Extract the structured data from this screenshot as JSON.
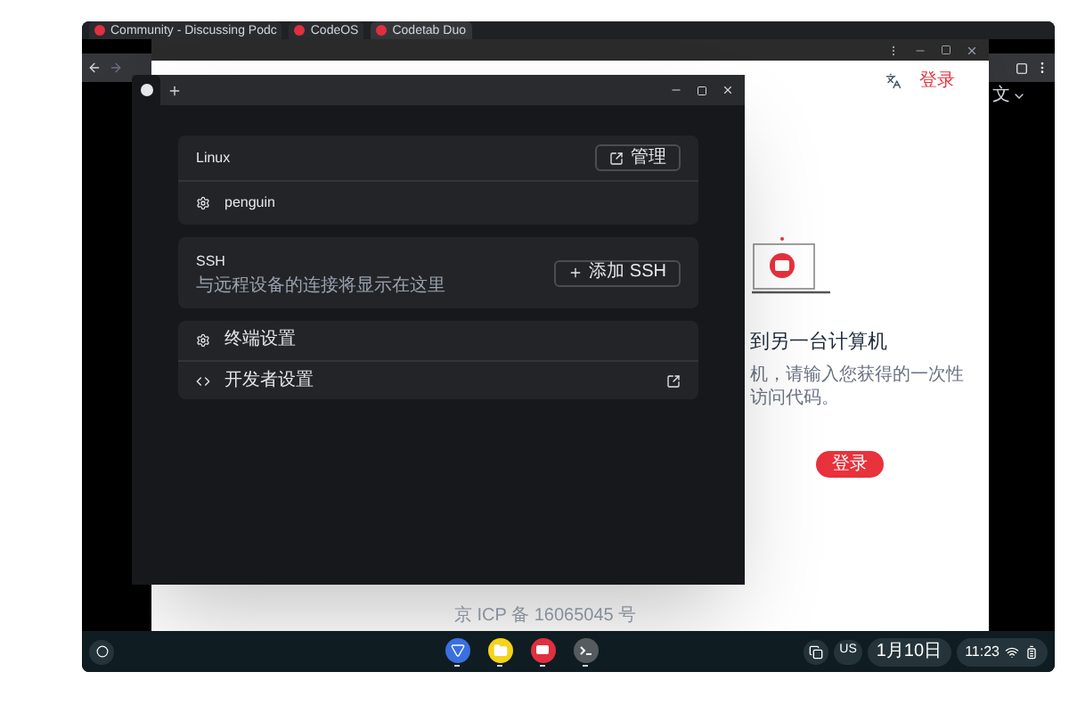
{
  "browser": {
    "tabs": [
      {
        "title": "Community - Discussing Podc",
        "selected": false
      },
      {
        "title": "CodeOS",
        "selected": false
      },
      {
        "title": "Codetab Duo",
        "selected": true
      }
    ]
  },
  "web_page": {
    "language": "文",
    "login_link": "登录",
    "heading": "到另一台计算机",
    "description": "机，请输入您获得的一次性访问代码。",
    "login_button": "登录",
    "footer": "京 ICP 备 16065045 号"
  },
  "terminal": {
    "tabs": [
      {
        "kind": "home",
        "selected": true
      },
      {
        "kind": "new",
        "selected": false
      }
    ],
    "linux": {
      "title": "Linux",
      "manage_button": "管理",
      "containers": [
        {
          "name": "penguin"
        }
      ]
    },
    "ssh": {
      "title": "SSH",
      "add_button": "添加 SSH",
      "description": "与远程设备的连接将显示在这里"
    },
    "settings": [
      {
        "kind": "gear",
        "label": "终端设置",
        "external": false
      },
      {
        "kind": "code",
        "label": "开发者设置",
        "external": true
      }
    ]
  },
  "shelf": {
    "apps": [
      {
        "kind": "browser",
        "running": true
      },
      {
        "kind": "files",
        "running": true
      },
      {
        "kind": "app",
        "running": true
      },
      {
        "kind": "terminal",
        "running": true
      }
    ],
    "keyboard": "US",
    "date": "1月10日",
    "time": "11:23"
  }
}
